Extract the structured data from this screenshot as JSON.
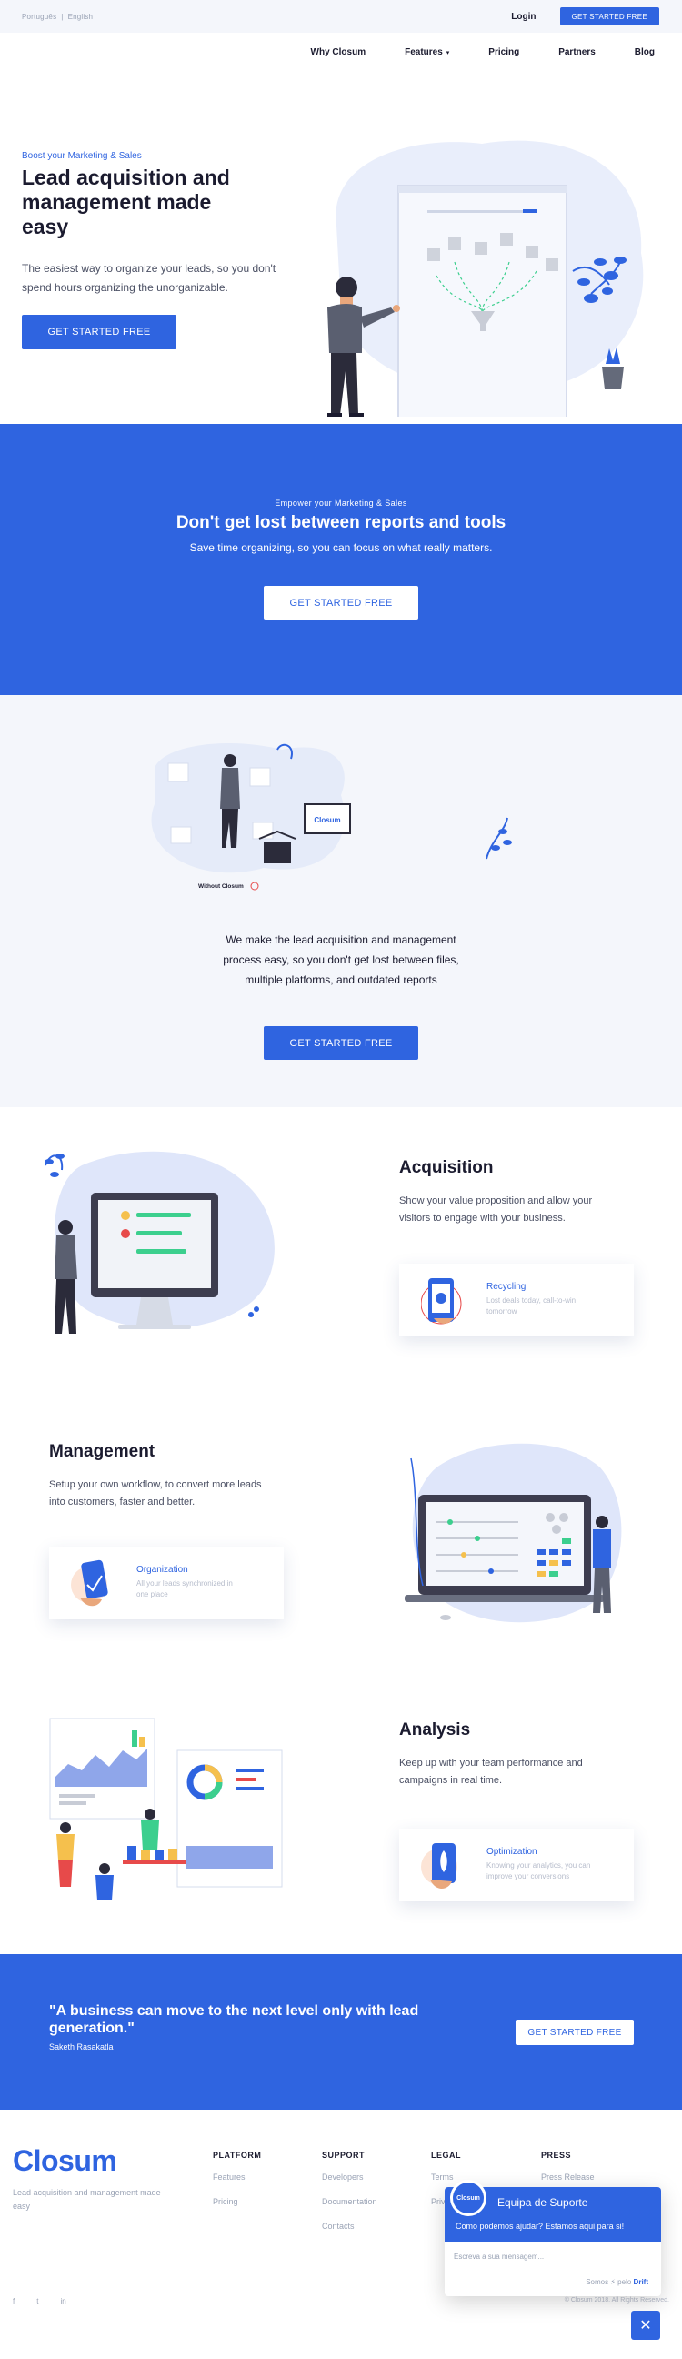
{
  "topbar": {
    "lang_pt": "Português",
    "lang_sep": "|",
    "lang_en": "English",
    "login": "Login",
    "cta": "GET STARTED FREE"
  },
  "nav": {
    "items": [
      "Why Closum",
      "Features",
      "Pricing",
      "Partners",
      "Blog"
    ],
    "features_caret": "▾"
  },
  "hero": {
    "kicker": "Boost your Marketing & Sales",
    "title": "Lead acquisition and management made easy",
    "desc": "The easiest way to organize your leads, so you don't spend hours organizing the unorganizable.",
    "cta": "GET STARTED FREE"
  },
  "band": {
    "kicker": "Empower your Marketing & Sales",
    "title": "Don't get lost between reports and tools",
    "subtitle": "Save time organizing, so you can focus on what really matters.",
    "cta": "GET STARTED FREE"
  },
  "nomore": {
    "label_without": "Without Closum",
    "label_logo": "Closum",
    "text": "We make the lead acquisition and management process easy, so you don't get lost between files, multiple platforms, and outdated reports",
    "cta": "GET STARTED FREE"
  },
  "acquisition": {
    "title": "Acquisition",
    "desc": "Show your value proposition and allow your visitors to engage with your business.",
    "card_title": "Recycling",
    "card_desc": "Lost deals today, call-to-win tomorrow"
  },
  "management": {
    "title": "Management",
    "desc": "Setup your own workflow, to convert more leads into customers, faster and better.",
    "card_title": "Organization",
    "card_desc": "All your leads synchronized in one place"
  },
  "analysis": {
    "title": "Analysis",
    "desc": "Keep up with your team performance and campaigns in real time.",
    "card_title": "Optimization",
    "card_desc": "Knowing your analytics, you can improve your conversions"
  },
  "quote": {
    "text": "\"A business can move to the next level only with lead generation.\"",
    "author": "Saketh Rasakatla",
    "cta": "GET STARTED FREE"
  },
  "footer": {
    "logo": "Closum",
    "tagline": "Lead acquisition and management made easy",
    "columns": [
      {
        "heading": "PLATFORM",
        "links": [
          "Features",
          "Pricing"
        ]
      },
      {
        "heading": "SUPPORT",
        "links": [
          "Developers",
          "Documentation",
          "Contacts"
        ]
      },
      {
        "heading": "LEGAL",
        "links": [
          "Terms",
          "Privacy"
        ]
      },
      {
        "heading": "PRESS",
        "links": [
          "Press Release"
        ]
      }
    ],
    "social": [
      "f",
      "t",
      "in"
    ],
    "copyright": "© Closum 2018. All Rights Reserved."
  },
  "chat": {
    "avatar": "Closum",
    "team": "Equipa de Suporte",
    "help": "Como podemos ajudar? Estamos aqui para si!",
    "placeholder": "Escreva a sua mensagem...",
    "powered_prefix": "Somos",
    "powered_mid": "⚡ pelo",
    "powered_brand": "Drift",
    "close": "✕"
  },
  "colors": {
    "brand": "#2f64e0",
    "background_light": "#f4f6fb",
    "text_dark": "#1b1b2f",
    "accent_green": "#3ccf8e"
  }
}
